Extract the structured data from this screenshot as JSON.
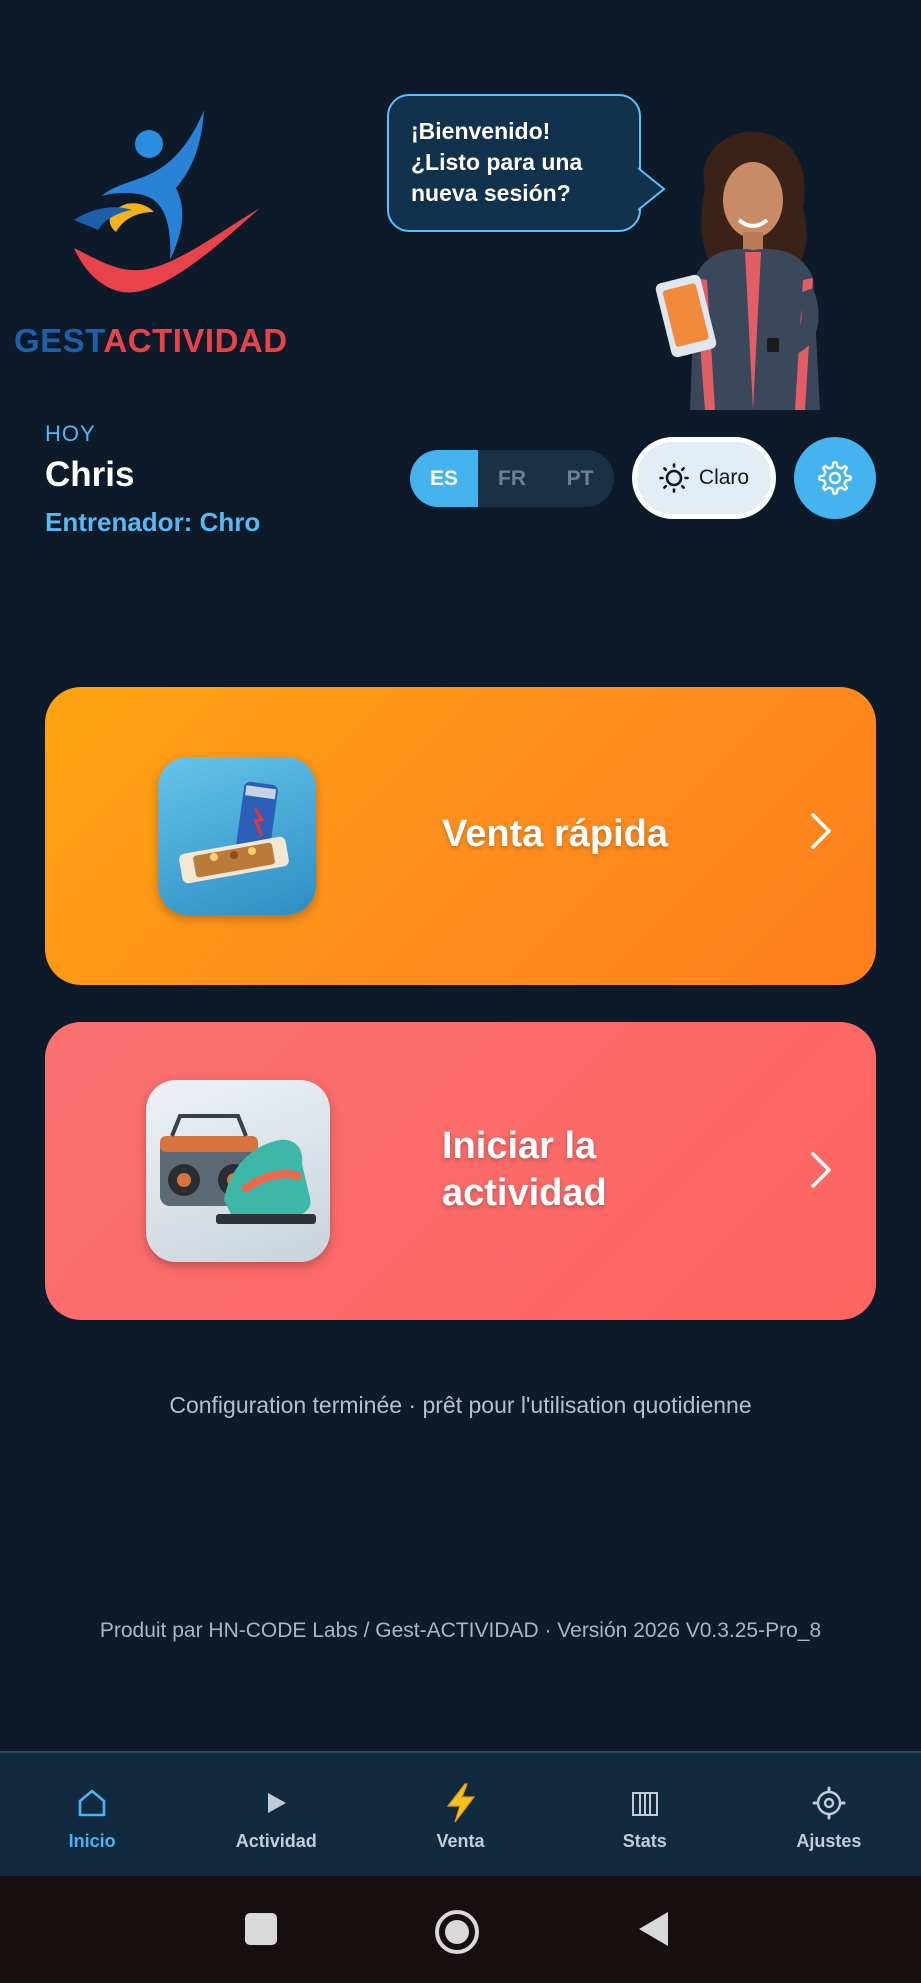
{
  "brand": {
    "word_part1": "GEST",
    "word_part2": "ACTIVIDAD"
  },
  "greeting": {
    "bubble_text": "¡Bienvenido! ¿Listo para una nueva sesión?"
  },
  "user": {
    "day_label": "HOY",
    "name": "Chris",
    "trainer": "Entrenador: Chro"
  },
  "languages": [
    {
      "code": "ES",
      "active": true
    },
    {
      "code": "FR",
      "active": false
    },
    {
      "code": "PT",
      "active": false
    }
  ],
  "theme_toggle": {
    "label": "Claro",
    "icon": "sun-icon"
  },
  "settings_button": {
    "icon": "gear-icon"
  },
  "actions": {
    "quick_sale": {
      "label": "Venta rápida",
      "icon": "energy-drink-snack-icon",
      "color_start": "#ffa30f",
      "color_end": "#ff7f1c"
    },
    "start_activity": {
      "label": "Iniciar la actividad",
      "icon": "boombox-sneaker-icon",
      "color_start": "#f97070",
      "color_end": "#ff6562"
    }
  },
  "status_line": "Configuration terminée · prêt pour l'utilisation quotidienne",
  "credits": "Produit par HN-CODE Labs / Gest-ACTIVIDAD · Versión 2026 V0.3.25-Pro_8",
  "bottom_nav": [
    {
      "label": "Inicio",
      "icon": "home-icon",
      "active": true
    },
    {
      "label": "Actividad",
      "icon": "play-icon",
      "active": false
    },
    {
      "label": "Venta",
      "icon": "lightning-icon",
      "active": false
    },
    {
      "label": "Stats",
      "icon": "stats-icon",
      "active": false
    },
    {
      "label": "Ajustes",
      "icon": "gear-icon",
      "active": false
    }
  ],
  "colors": {
    "background": "#0c1a2a",
    "accent": "#45b3ee",
    "nav_bg": "#112a40"
  }
}
